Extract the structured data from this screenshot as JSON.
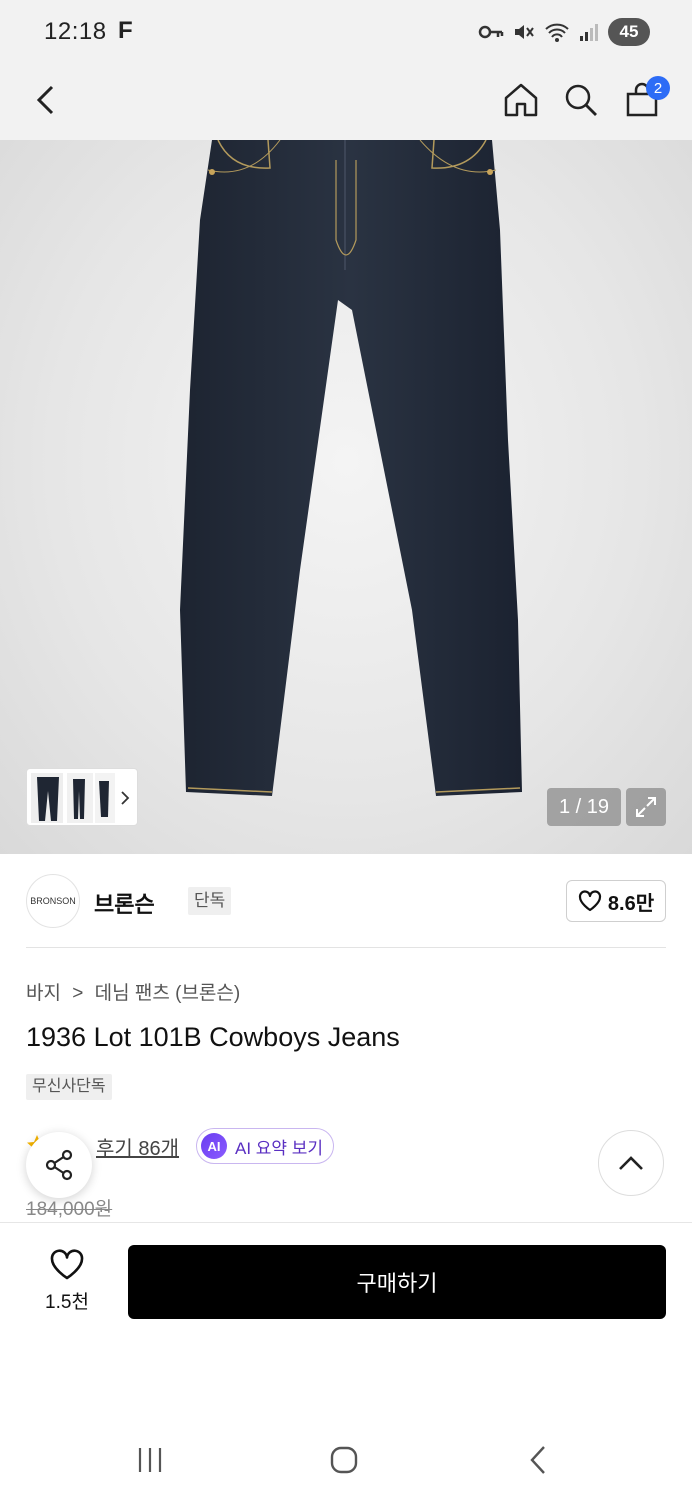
{
  "status_bar": {
    "time": "12:18",
    "carrier_glyph": "F",
    "battery": "45",
    "icons": [
      "key-icon",
      "mute-icon",
      "wifi-icon",
      "signal-icon"
    ]
  },
  "app_bar": {
    "icons": [
      "back-icon",
      "home-icon",
      "search-icon",
      "cart-icon"
    ],
    "cart_count": "2"
  },
  "gallery": {
    "counter": "1 / 19"
  },
  "brand": {
    "logo_text": "BRONSON",
    "name": "브론슨",
    "exclusive_tag": "단독",
    "like_count": "8.6만"
  },
  "product": {
    "breadcrumb_category": "바지",
    "breadcrumb_sub": "데님 팬츠 (브론슨)",
    "title": "1936 Lot 101B Cowboys Jeans",
    "tag": "무신사단독",
    "review_label": "후기 86개",
    "ai_badge": "AI",
    "ai_summary_label": "AI 요약 보기",
    "original_price": "184,000원"
  },
  "bottom_bar": {
    "wish_count": "1.5천",
    "buy_label": "구매하기"
  },
  "colors": {
    "accent_blue": "#2d6cf6",
    "ai_purple": "#6a3df0",
    "buy_black": "#000000"
  }
}
